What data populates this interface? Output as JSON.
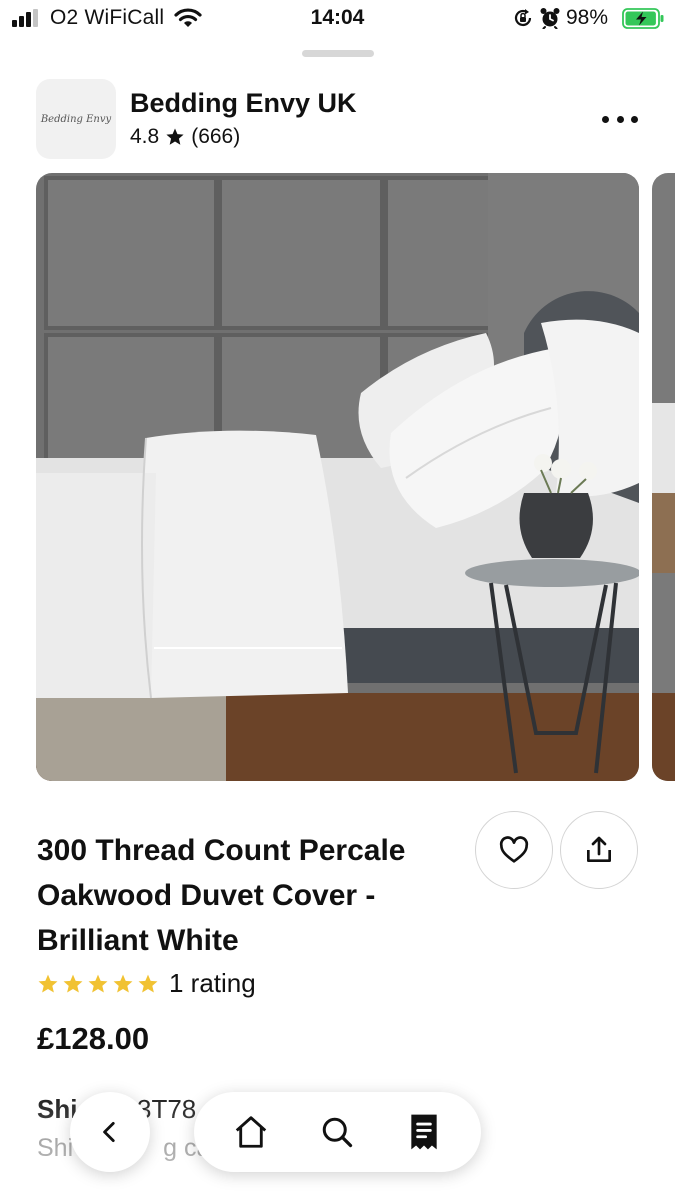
{
  "status_bar": {
    "carrier": "O2 WiFiCall",
    "time": "14:04",
    "battery": "98%",
    "battery_level": 0.98
  },
  "shop": {
    "logo_text": "Bedding Envy",
    "name": "Bedding Envy UK",
    "rating": "4.8",
    "review_count": "(666)"
  },
  "product": {
    "title_lines": [
      "300 Thread Count Percale",
      "Oakwood Duvet Cover -",
      "Brilliant White"
    ],
    "stars": 5,
    "rating_text": "1 rating",
    "price": "£128.00"
  },
  "shipping": {
    "title_visible": "Shi",
    "code_visible": "3T78",
    "sub_start": "Shi",
    "sub_end": "g cal"
  },
  "nav": {
    "tabs": [
      "home",
      "search",
      "receipt"
    ]
  },
  "colors": {
    "star": "#f1c232",
    "text": "#111111",
    "muted": "#888888",
    "battery_green": "#34c759"
  },
  "icons": [
    "signal-icon",
    "wifi-icon",
    "rotation-lock-icon",
    "alarm-icon",
    "battery-icon",
    "star-icon",
    "more-icon",
    "heart-icon",
    "share-icon",
    "back-icon",
    "home-icon",
    "search-icon",
    "receipt-icon"
  ]
}
